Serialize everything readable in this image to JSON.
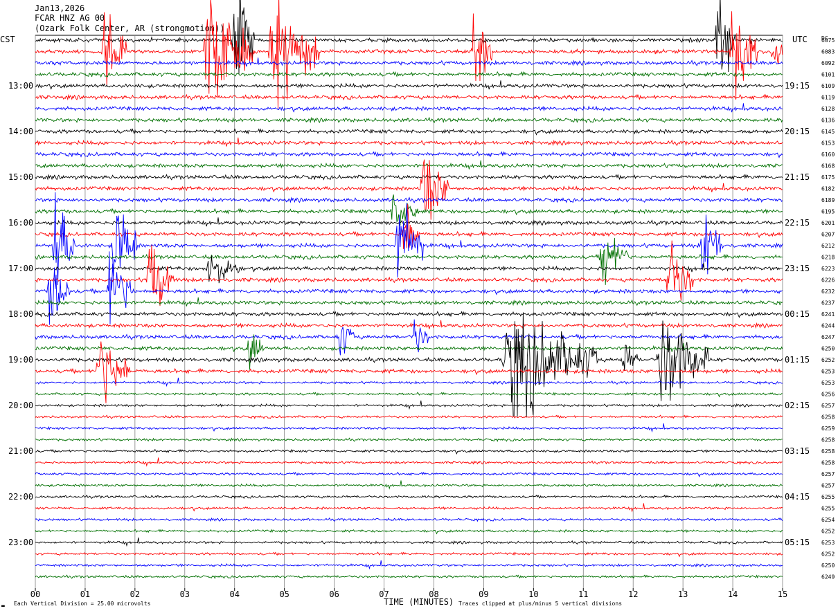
{
  "header": {
    "date": "Jan13,2026",
    "station": "FCAR HNZ AG 00",
    "location": "(Ozark Folk Center, AR (strongmotion))"
  },
  "axes": {
    "left_zone": "CST",
    "right_zone": "UTC",
    "dc_header": "DC",
    "x_title": "TIME (MINUTES)"
  },
  "footer": {
    "scale_note": "Each Vertical Division =   25.00 microvolts",
    "clip_note": "Traces clipped at plus/minus 5 vertical divisions",
    "corner_mark": "▬"
  },
  "colors": {
    "trace_cycle": [
      "#000000",
      "#ff0000",
      "#0000ff",
      "#007000"
    ],
    "grid": "#808080"
  },
  "chart_data": {
    "type": "line",
    "description_type": "helicorder",
    "x_axis": {
      "min": 0,
      "max": 15,
      "ticks": [
        "00",
        "01",
        "02",
        "03",
        "04",
        "05",
        "06",
        "07",
        "08",
        "09",
        "10",
        "11",
        "12",
        "13",
        "14",
        "15"
      ]
    },
    "left_time_labels": [
      "13:00",
      "14:00",
      "15:00",
      "16:00",
      "17:00",
      "18:00",
      "19:00",
      "20:00",
      "21:00",
      "22:00",
      "23:00"
    ],
    "right_time_labels": [
      "19:15",
      "20:15",
      "21:15",
      "22:15",
      "23:15",
      "00:15",
      "01:15",
      "02:15",
      "03:15",
      "04:15",
      "05:15"
    ],
    "line_count": 48,
    "dc_offsets": [
      "6075",
      "6083",
      "6092",
      "6101",
      "6109",
      "6119",
      "6128",
      "6136",
      "6145",
      "6153",
      "6160",
      "6168",
      "6175",
      "6182",
      "6189",
      "6195",
      "6201",
      "6207",
      "6212",
      "6218",
      "6223",
      "6226",
      "6232",
      "6237",
      "6241",
      "6244",
      "6247",
      "6250",
      "6252",
      "6253",
      "6253",
      "6256",
      "6257",
      "6258",
      "6259",
      "6258",
      "6258",
      "6258",
      "6257",
      "6257",
      "6255",
      "6255",
      "6254",
      "6252",
      "6253",
      "6252",
      "6250",
      "6249"
    ],
    "events": [
      {
        "line": 1,
        "minute": 1.4,
        "dur": 0.45,
        "amp": 5
      },
      {
        "line": 1,
        "minute": 3.5,
        "dur": 0.9,
        "amp": 5
      },
      {
        "line": 1,
        "minute": 4.8,
        "dur": 0.9,
        "amp": 5
      },
      {
        "line": 1,
        "minute": 8.8,
        "dur": 0.4,
        "amp": 4
      },
      {
        "line": 1,
        "minute": 14.0,
        "dur": 0.5,
        "amp": 5
      },
      {
        "line": 1,
        "minute": 14.8,
        "dur": 0.3,
        "amp": 2
      },
      {
        "line": 0,
        "minute": 4.0,
        "dur": 0.4,
        "amp": 5
      },
      {
        "line": 0,
        "minute": 13.7,
        "dur": 0.35,
        "amp": 5
      },
      {
        "line": 13,
        "minute": 7.8,
        "dur": 0.5,
        "amp": 4
      },
      {
        "line": 15,
        "minute": 7.2,
        "dur": 0.5,
        "amp": 2
      },
      {
        "line": 17,
        "minute": 7.4,
        "dur": 0.3,
        "amp": 4
      },
      {
        "line": 18,
        "minute": 0.4,
        "dur": 0.4,
        "amp": 5
      },
      {
        "line": 18,
        "minute": 1.6,
        "dur": 0.45,
        "amp": 5
      },
      {
        "line": 18,
        "minute": 7.3,
        "dur": 0.5,
        "amp": 5
      },
      {
        "line": 18,
        "minute": 13.4,
        "dur": 0.4,
        "amp": 4
      },
      {
        "line": 19,
        "minute": 11.4,
        "dur": 0.5,
        "amp": 3
      },
      {
        "line": 20,
        "minute": 3.5,
        "dur": 0.6,
        "amp": 2
      },
      {
        "line": 21,
        "minute": 2.3,
        "dur": 0.5,
        "amp": 4
      },
      {
        "line": 21,
        "minute": 12.7,
        "dur": 0.5,
        "amp": 4
      },
      {
        "line": 22,
        "minute": 0.3,
        "dur": 0.4,
        "amp": 4
      },
      {
        "line": 22,
        "minute": 1.5,
        "dur": 0.5,
        "amp": 4
      },
      {
        "line": 26,
        "minute": 6.1,
        "dur": 0.3,
        "amp": 2
      },
      {
        "line": 26,
        "minute": 7.6,
        "dur": 0.3,
        "amp": 2
      },
      {
        "line": 27,
        "minute": 4.3,
        "dur": 0.3,
        "amp": 2
      },
      {
        "line": 28,
        "minute": 9.6,
        "dur": 1.7,
        "amp": 5
      },
      {
        "line": 28,
        "minute": 12.6,
        "dur": 0.9,
        "amp": 5
      },
      {
        "line": 28,
        "minute": 11.8,
        "dur": 0.3,
        "amp": 2
      },
      {
        "line": 29,
        "minute": 1.3,
        "dur": 0.6,
        "amp": 4
      }
    ]
  }
}
